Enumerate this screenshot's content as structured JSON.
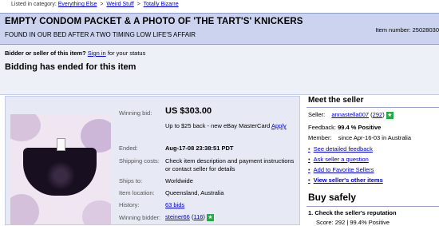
{
  "breadcrumb": {
    "prefix": "Listed in category:",
    "items": [
      "Everything Else",
      "Weird Stuff",
      "Totally Bizarre"
    ],
    "separator": ">"
  },
  "listing": {
    "title": "EMPTY CONDOM PACKET & A PHOTO OF 'THE TART'S' KNICKERS",
    "subtitle": "FOUND IN OUR BED AFTER A TWO TIMING LOW LIFE'S AFFAIR",
    "item_number": "Item number: 25028030"
  },
  "status": {
    "question": "Bidder or seller of this item?",
    "sign_in": "Sign in",
    "question_suffix": "for your status",
    "message": "Bidding has ended for this item"
  },
  "details": {
    "winning_bid_label": "Winning bid:",
    "winning_bid_value": "US $303.00",
    "promo_text": "Up to $25 back - new eBay MasterCard",
    "promo_link": "Apply",
    "ended_label": "Ended:",
    "ended_value": "Aug-17-08 23:38:51 PDT",
    "shipping_label": "Shipping costs:",
    "shipping_value_line1": "Check item description and payment instructions",
    "shipping_value_line2": "or contact seller for details",
    "ships_to_label": "Ships to:",
    "ships_to_value": "Worldwide",
    "location_label": "Item location:",
    "location_value": "Queensland, Australia",
    "history_label": "History:",
    "history_value": "63 bids",
    "winning_bidder_label": "Winning bidder:",
    "winning_bidder_name": "steiner66",
    "winning_bidder_score": "116",
    "bidder_score_open": "(",
    "bidder_score_close": ")"
  },
  "seller": {
    "heading": "Meet the seller",
    "seller_label": "Seller:",
    "seller_name": "annastella007",
    "seller_score": "292",
    "score_open": "(",
    "score_close": ")",
    "feedback_label": "Feedback:",
    "feedback_value": "99.4 % Positive",
    "member_label": "Member:",
    "member_value": "since Apr-16-03 in Australia",
    "links": [
      "See detailed feedback",
      "Ask seller a question",
      "Add to Favorite Sellers",
      "View seller's other items"
    ]
  },
  "buy_safely": {
    "heading": "Buy safely",
    "step": "1.  Check the seller's reputation",
    "sub": "Score: 292 | 99.4% Positive"
  },
  "colors": {
    "title_bg": "#ccd3ef",
    "panel_bg": "#e7eaf5",
    "link": "#0000cc",
    "star": "#2aa64a"
  }
}
